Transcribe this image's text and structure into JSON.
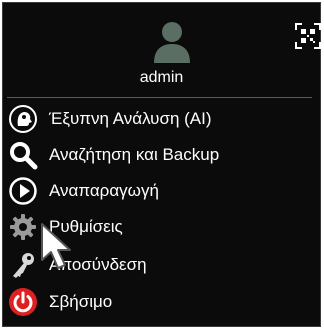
{
  "header": {
    "username": "admin",
    "avatar_icon": "user-avatar-icon",
    "qr_icon": "qr-code-icon"
  },
  "menu": {
    "items": [
      {
        "label": "Έξυπνη Ανάλυση (AI)",
        "icon": "ai-head-icon"
      },
      {
        "label": "Αναζήτηση και Backup",
        "icon": "search-icon"
      },
      {
        "label": "Αναπαραγωγή",
        "icon": "play-icon"
      },
      {
        "label": "Ρυθμίσεις",
        "icon": "gear-icon"
      },
      {
        "label": "Αποσύνδεση",
        "icon": "key-icon"
      },
      {
        "label": "Σβήσιμο",
        "icon": "power-icon"
      }
    ]
  },
  "colors": {
    "background": "#0b0b0b",
    "text": "#ffffff",
    "avatar": "#5b6e63",
    "power": "#e02020"
  }
}
